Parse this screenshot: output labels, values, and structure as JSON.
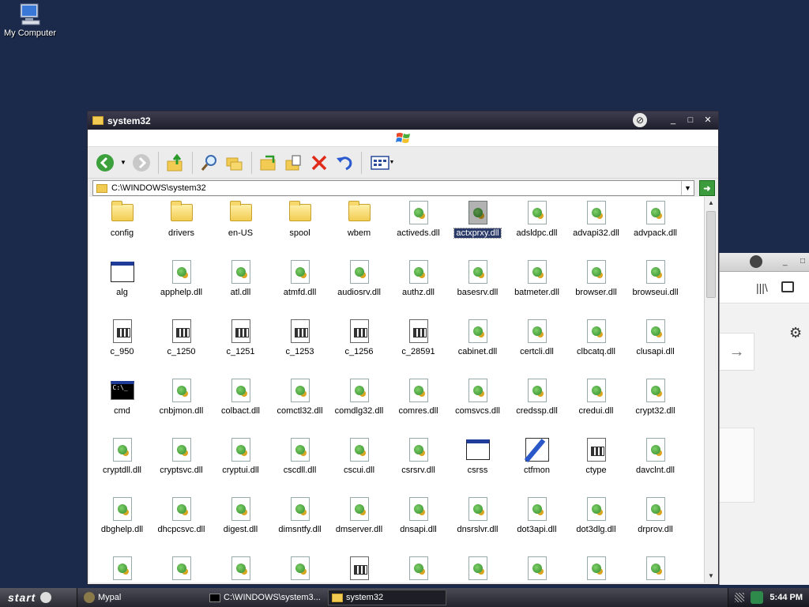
{
  "desktop": {
    "my_computer_label": "My Computer"
  },
  "window": {
    "title": "system32",
    "address": "C:\\WINDOWS\\system32"
  },
  "items": [
    {
      "label": "config",
      "icon": "folder"
    },
    {
      "label": "drivers",
      "icon": "folder"
    },
    {
      "label": "en-US",
      "icon": "folder"
    },
    {
      "label": "spool",
      "icon": "folder"
    },
    {
      "label": "wbem",
      "icon": "folder"
    },
    {
      "label": "activeds.dll",
      "icon": "dll"
    },
    {
      "label": "actxprxy.dll",
      "icon": "dll",
      "selected": true
    },
    {
      "label": "adsldpc.dll",
      "icon": "dll"
    },
    {
      "label": "advapi32.dll",
      "icon": "dll"
    },
    {
      "label": "advpack.dll",
      "icon": "dll"
    },
    {
      "label": "alg",
      "icon": "app"
    },
    {
      "label": "apphelp.dll",
      "icon": "dll"
    },
    {
      "label": "atl.dll",
      "icon": "dll"
    },
    {
      "label": "atmfd.dll",
      "icon": "dll"
    },
    {
      "label": "audiosrv.dll",
      "icon": "dll"
    },
    {
      "label": "authz.dll",
      "icon": "dll"
    },
    {
      "label": "basesrv.dll",
      "icon": "dll"
    },
    {
      "label": "batmeter.dll",
      "icon": "dll"
    },
    {
      "label": "browser.dll",
      "icon": "dll"
    },
    {
      "label": "browseui.dll",
      "icon": "dll"
    },
    {
      "label": "c_950",
      "icon": "nls"
    },
    {
      "label": "c_1250",
      "icon": "nls"
    },
    {
      "label": "c_1251",
      "icon": "nls"
    },
    {
      "label": "c_1253",
      "icon": "nls"
    },
    {
      "label": "c_1256",
      "icon": "nls"
    },
    {
      "label": "c_28591",
      "icon": "nls"
    },
    {
      "label": "cabinet.dll",
      "icon": "dll"
    },
    {
      "label": "certcli.dll",
      "icon": "dll"
    },
    {
      "label": "clbcatq.dll",
      "icon": "dll"
    },
    {
      "label": "clusapi.dll",
      "icon": "dll"
    },
    {
      "label": "cmd",
      "icon": "cmd"
    },
    {
      "label": "cnbjmon.dll",
      "icon": "dll"
    },
    {
      "label": "colbact.dll",
      "icon": "dll"
    },
    {
      "label": "comctl32.dll",
      "icon": "dll"
    },
    {
      "label": "comdlg32.dll",
      "icon": "dll"
    },
    {
      "label": "comres.dll",
      "icon": "dll"
    },
    {
      "label": "comsvcs.dll",
      "icon": "dll"
    },
    {
      "label": "credssp.dll",
      "icon": "dll"
    },
    {
      "label": "credui.dll",
      "icon": "dll"
    },
    {
      "label": "crypt32.dll",
      "icon": "dll"
    },
    {
      "label": "cryptdll.dll",
      "icon": "dll"
    },
    {
      "label": "cryptsvc.dll",
      "icon": "dll"
    },
    {
      "label": "cryptui.dll",
      "icon": "dll"
    },
    {
      "label": "cscdll.dll",
      "icon": "dll"
    },
    {
      "label": "cscui.dll",
      "icon": "dll"
    },
    {
      "label": "csrsrv.dll",
      "icon": "dll"
    },
    {
      "label": "csrss",
      "icon": "app"
    },
    {
      "label": "ctfmon",
      "icon": "ctf"
    },
    {
      "label": "ctype",
      "icon": "nls"
    },
    {
      "label": "davclnt.dll",
      "icon": "dll"
    },
    {
      "label": "dbghelp.dll",
      "icon": "dll"
    },
    {
      "label": "dhcpcsvc.dll",
      "icon": "dll"
    },
    {
      "label": "digest.dll",
      "icon": "dll"
    },
    {
      "label": "dimsntfy.dll",
      "icon": "dll"
    },
    {
      "label": "dmserver.dll",
      "icon": "dll"
    },
    {
      "label": "dnsapi.dll",
      "icon": "dll"
    },
    {
      "label": "dnsrslvr.dll",
      "icon": "dll"
    },
    {
      "label": "dot3api.dll",
      "icon": "dll"
    },
    {
      "label": "dot3dlg.dll",
      "icon": "dll"
    },
    {
      "label": "drprov.dll",
      "icon": "dll"
    },
    {
      "label": "",
      "icon": "dll"
    },
    {
      "label": "",
      "icon": "dll"
    },
    {
      "label": "",
      "icon": "dll"
    },
    {
      "label": "",
      "icon": "dll"
    },
    {
      "label": "",
      "icon": "nls"
    },
    {
      "label": "",
      "icon": "dll"
    },
    {
      "label": "",
      "icon": "dll"
    },
    {
      "label": "",
      "icon": "dll"
    },
    {
      "label": "",
      "icon": "dll"
    },
    {
      "label": "",
      "icon": "dll"
    }
  ],
  "taskbar": {
    "start_label": "start",
    "tasks": [
      {
        "label": "Mypal",
        "active": false
      },
      {
        "label": "C:\\WINDOWS\\system3...",
        "active": false
      },
      {
        "label": "system32",
        "active": true
      }
    ],
    "clock": "5:44 PM"
  }
}
